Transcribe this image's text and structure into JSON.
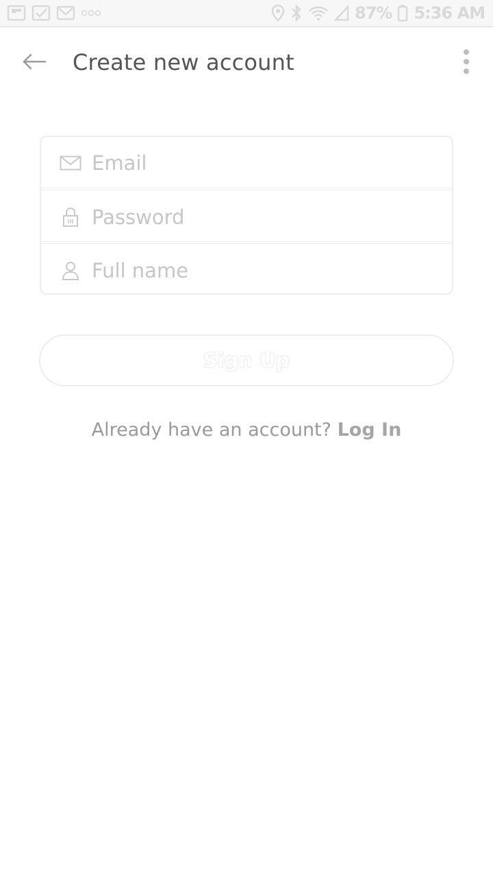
{
  "status_bar": {
    "battery_text": "87%",
    "time": "5:36 AM",
    "left_icons": [
      "flipboard-icon",
      "check-icon",
      "gmail-icon",
      "more-notifications-icon"
    ],
    "right_icons": [
      "location-icon",
      "bluetooth-icon",
      "wifi-icon",
      "signal-icon",
      "battery-icon"
    ]
  },
  "app_bar": {
    "title": "Create new account",
    "back_icon": "arrow-left-icon",
    "menu_icon": "more-vertical-icon"
  },
  "form": {
    "email": {
      "placeholder": "Email",
      "value": "",
      "icon": "mail-icon"
    },
    "password": {
      "placeholder": "Password",
      "value": "",
      "icon": "lock-icon"
    },
    "full_name": {
      "placeholder": "Full name",
      "value": "",
      "icon": "person-icon"
    }
  },
  "signup": {
    "label": "Sign Up"
  },
  "login_prompt": {
    "text": "Already have an account? ",
    "link": "Log In"
  },
  "colors": {
    "background": "#ffffff",
    "status_bar_bg": "#f7f7f7",
    "muted_text": "#9a9a9a",
    "placeholder": "#c6c6c6",
    "border": "#eeeeee"
  }
}
